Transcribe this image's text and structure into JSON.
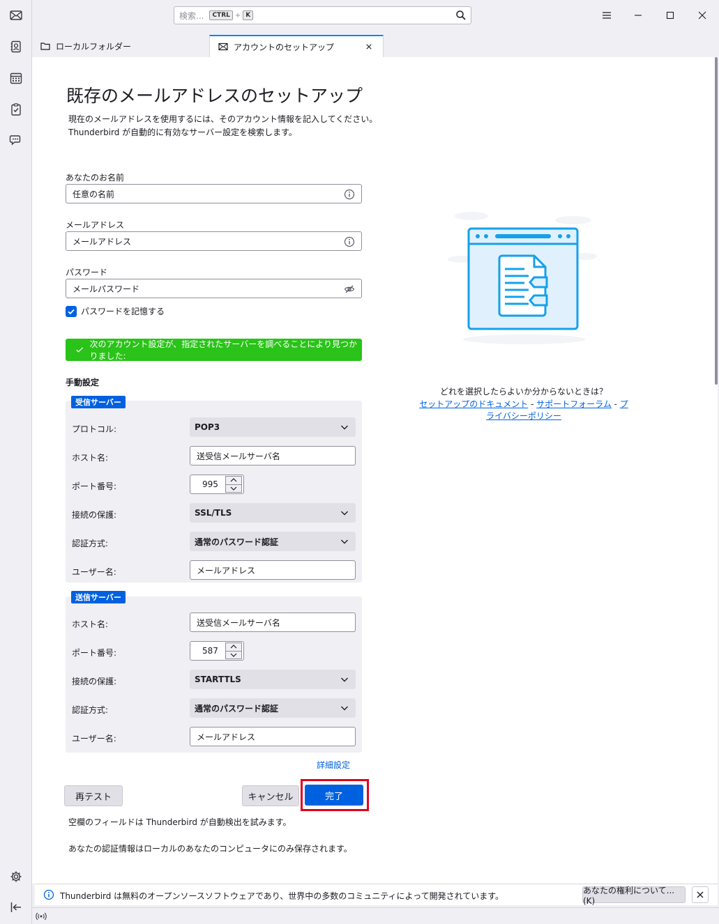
{
  "search": {
    "placeholder": "検索...",
    "shortcut_key1": "CTRL",
    "shortcut_plus": "+",
    "shortcut_key2": "K"
  },
  "tabs": [
    {
      "label": "ローカルフォルダー",
      "icon": "folder-icon"
    },
    {
      "label": "アカウントのセットアップ",
      "icon": "mail-setup-icon"
    }
  ],
  "page": {
    "title": "既存のメールアドレスのセットアップ",
    "desc_line1": "現在のメールアドレスを使用するには、そのアカウント情報を記入してください。",
    "desc_line2": "Thunderbird が自動的に有効なサーバー設定を検索します。"
  },
  "form": {
    "name_label": "あなたのお名前",
    "name_value": "任意の名前",
    "email_label": "メールアドレス",
    "email_value": "メールアドレス",
    "password_label": "パスワード",
    "password_value": "メールパスワード",
    "remember_label": "パスワードを記憶する",
    "remember_checked": true
  },
  "success_message": "次のアカウント設定が、指定されたサーバーを調べることにより見つかりました:",
  "manual": {
    "title": "手動設定",
    "incoming": {
      "badge": "受信サーバー",
      "protocol_label": "プロトコル:",
      "protocol_value": "POP3",
      "host_label": "ホスト名:",
      "host_value": "送受信メールサーバ名",
      "port_label": "ポート番号:",
      "port_value": "995",
      "security_label": "接続の保護:",
      "security_value": "SSL/TLS",
      "auth_label": "認証方式:",
      "auth_value": "通常のパスワード認証",
      "user_label": "ユーザー名:",
      "user_value": "メールアドレス"
    },
    "outgoing": {
      "badge": "送信サーバー",
      "host_label": "ホスト名:",
      "host_value": "送受信メールサーバ名",
      "port_label": "ポート番号:",
      "port_value": "587",
      "security_label": "接続の保護:",
      "security_value": "STARTTLS",
      "auth_label": "認証方式:",
      "auth_value": "通常のパスワード認証",
      "user_label": "ユーザー名:",
      "user_value": "メールアドレス"
    },
    "advanced_link": "詳細設定"
  },
  "buttons": {
    "retest": "再テスト",
    "cancel": "キャンセル",
    "done": "完了"
  },
  "footnotes": {
    "line1": "空欄のフィールドは Thunderbird が自動検出を試みます。",
    "line2": "あなたの認証情報はローカルのあなたのコンピュータにのみ保存されます。"
  },
  "help": {
    "question": "どれを選択したらよいか分からないときは？",
    "link_docs": "セットアップのドキュメント",
    "sep1": " - ",
    "link_forum": "サポートフォーラム",
    "sep2": " - ",
    "link_privacy": "プライバシーポリシー"
  },
  "notification": {
    "text": "Thunderbird は無料のオープンソースソフトウェアであり、世界中の多数のコミュニティによって開発されています。",
    "button": "あなたの権利について...(K)"
  },
  "colors": {
    "accent": "#0061e0",
    "success": "#2ac319",
    "highlight": "#e0001b"
  }
}
